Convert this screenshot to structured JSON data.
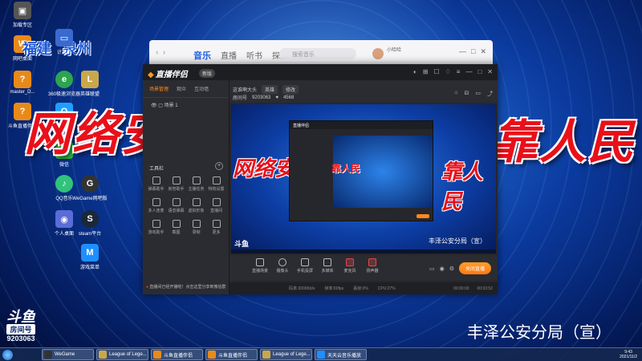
{
  "desktop": {
    "icons": [
      {
        "label": "加载专区",
        "color": "#555"
      },
      {
        "label": "福建",
        "color": "#e88a1a"
      },
      {
        "label": "计算机",
        "color": "#3a6ad0"
      },
      {
        "label": "网吧桌面",
        "color": "#e88a1a"
      },
      {
        "label": "master_D...",
        "color": "#e88a1a"
      },
      {
        "label": "360极速浏览器",
        "color": "#2da44e"
      },
      {
        "label": "英雄联盟",
        "color": "#c9a84b"
      },
      {
        "label": "斗鱼直播伴侣",
        "color": "#e88a1a"
      },
      {
        "label": "QQ",
        "color": "#1e9fff"
      },
      {
        "label": "微信",
        "color": "#2cc23a"
      },
      {
        "label": "QQ音乐",
        "color": "#31c27c"
      },
      {
        "label": "WeGame网吧版",
        "color": "#333"
      },
      {
        "label": "个人桌面",
        "color": "#5b6bd8"
      },
      {
        "label": "steam平台",
        "color": "#1b2838"
      },
      {
        "label": "游戏菜单",
        "color": "#1e8fff"
      }
    ],
    "city_fujian": "福建",
    "city_quanzhou": "泉州",
    "banner_left": "网络安",
    "banner_right": "靠人民",
    "caption": "丰泽公安分局（宣）",
    "douyu_logo": "斗鱼",
    "douyu_sub": "房间号",
    "douyu_room": "9203063"
  },
  "browser": {
    "tabs": [
      "音乐",
      "直播",
      "听书",
      "探索"
    ],
    "active_tab": 0,
    "search_placeholder": "搜索音乐",
    "user_name": "小哈哈"
  },
  "app": {
    "title": "直播伴侣",
    "vip": "新版",
    "left_tabs": [
      "场景管理",
      "观众",
      "互动墙"
    ],
    "scene": "场景 1",
    "tools_title": "工具栏",
    "tools": [
      "弹幕助手",
      "房管助手",
      "主播任务",
      "特效设置",
      "多人连麦",
      "语音弹幕",
      "虚拟形象",
      "直播间",
      "游戏助手",
      "截图",
      "录制",
      "更多"
    ],
    "notice": "直播间已经开播啦！点击这里分享到微信群",
    "stream_title": "这谁啊大头",
    "category": "英雄",
    "edit_label": "修改",
    "room_label": "房间号",
    "room_id": "9203063",
    "fans": "4568",
    "bottom_tools": [
      "直播场景",
      "摄像头",
      "手机投屏",
      "多媒体",
      "麦克风",
      "扬声器"
    ],
    "go_live": "关闭直播",
    "status": {
      "fps": "帧率:60fps",
      "bitrate": "码率:3000Kb/s",
      "cpu": "CPU:27%",
      "dropped": "丢帧:0%",
      "time_left": "00:00:00",
      "time_right": "00:03:52"
    },
    "preview_caption": "丰泽公安分局（宣）",
    "preview_logo": "斗鱼"
  },
  "taskbar": {
    "items": [
      {
        "label": "WeGame",
        "color": "#333"
      },
      {
        "label": "League of Lege...",
        "color": "#c9a84b"
      },
      {
        "label": "斗鱼直播伴侣",
        "color": "#e88a1a"
      },
      {
        "label": "斗鱼直播伴侣",
        "color": "#e88a1a"
      },
      {
        "label": "League of Lege...",
        "color": "#c9a84b"
      },
      {
        "label": "天天云音乐播放",
        "color": "#1e8fff"
      }
    ],
    "time": "9:43",
    "date": "2021/11/2"
  }
}
